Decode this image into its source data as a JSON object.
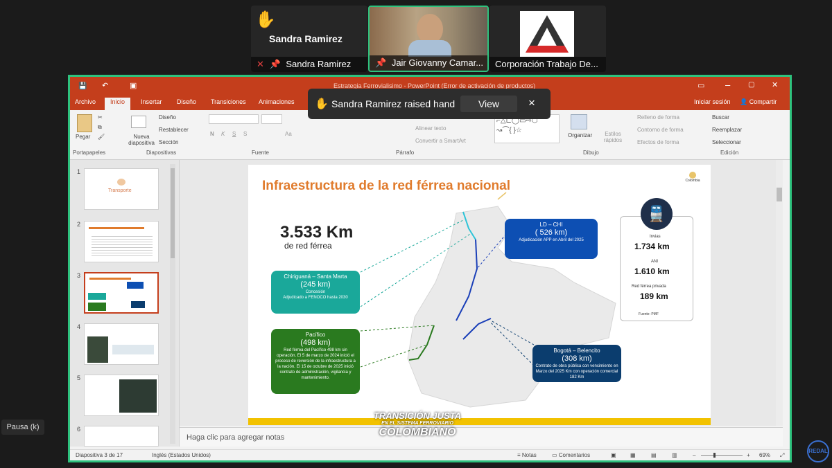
{
  "participants": [
    {
      "name": "Sandra Ramirez",
      "tile_label": "Sandra Ramirez"
    },
    {
      "name": "Jair Giovanny Camar..."
    },
    {
      "name": "Corporación Trabajo De..."
    }
  ],
  "notification": {
    "text": "Sandra Ramirez raised hand",
    "view_label": "View",
    "close": "×"
  },
  "ppt": {
    "title": "Estrategia Ferrovialisimo - PowerPoint (Error de activación de productos)",
    "tabs": [
      "Archivo",
      "Inicio",
      "Insertar",
      "Diseño",
      "Transiciones",
      "Animaciones"
    ],
    "active_tab": "Inicio",
    "signin": "Iniciar sesión",
    "share": "Compartir",
    "ribbon": {
      "paste": "Pegar",
      "new_slide": "Nueva diapositiva",
      "layout": "Diseño",
      "reset": "Restablecer",
      "section": "Sección",
      "align_text": "Alinear texto",
      "smartart": "Convertir a SmartArt",
      "arrange": "Organizar",
      "quick_styles": "Estilos rápidos",
      "fill": "Relleno de forma",
      "outline": "Contorno de forma",
      "effects": "Efectos de forma",
      "find": "Buscar",
      "replace": "Reemplazar",
      "select": "Seleccionar",
      "groups": {
        "clipboard": "Portapapeles",
        "slides": "Diapositivas",
        "font": "Fuente",
        "paragraph": "Párrafo",
        "drawing": "Dibujo",
        "editing": "Edición"
      }
    },
    "thumb_numbers": [
      "1",
      "2",
      "3",
      "4",
      "5",
      "6"
    ],
    "thumb_texts": {
      "t1": "Transporte"
    },
    "notes_placeholder": "Haga clic para agregar notas",
    "status": {
      "slide": "Diapositiva 3 de 17",
      "lang": "Inglés (Estados Unidos)",
      "notes": "Notas",
      "comments": "Comentarios",
      "zoom": "69%"
    }
  },
  "slide": {
    "title": "Infraestructura de la red férrea nacional",
    "total_km": "3.533 Km",
    "total_label": "de red férrea",
    "logo_text": "Colombia",
    "boxes": {
      "ld": {
        "title": "LD – CHI",
        "km": "( 526 km)",
        "desc": "Adjudicación APP en Abril del 2025",
        "color": "#0d4fb3"
      },
      "chiriguana": {
        "title": "Chiriguaná – Santa Marta",
        "km": "(245 km)",
        "desc1": "Concesión",
        "desc2": "Adjudicado a FENOCO hasta 2030",
        "color": "#1aa89a"
      },
      "pacifico": {
        "title": "Pacífico",
        "km": "(498 km)",
        "desc": "Red férrea del Pacífico 498 km sin operación. El 5 de marzo de 2024 inició el proceso de reversión de la infraestructura a la nación. El 15 de octubre de 2025 inició contrato de administración, vigilancia y mantenimiento.",
        "color": "#2a7a1f"
      },
      "bogota": {
        "title": "Bogotá – Belencito",
        "km": "(308 km)",
        "desc": "Contrato de obra pública con vencimiento en Marzo del 2025 Km con operación comercial 182 Km",
        "color": "#0b3d6e"
      }
    },
    "stats": {
      "invias_label": "Invias",
      "invias": "1.734 km",
      "ani_label": "ANI",
      "ani": "1.610 km",
      "private_label": "Red férrea privada",
      "private": "189 km",
      "source": "Fuente: PMF"
    },
    "watermark1": "TRANSICIÓN JUSTA",
    "watermark2": "EN EL SISTEMA FERROVIARIO",
    "watermark3": "COLOMBIANO"
  },
  "pause_label": "Pausa (k)",
  "corner_logo": "REDAL"
}
